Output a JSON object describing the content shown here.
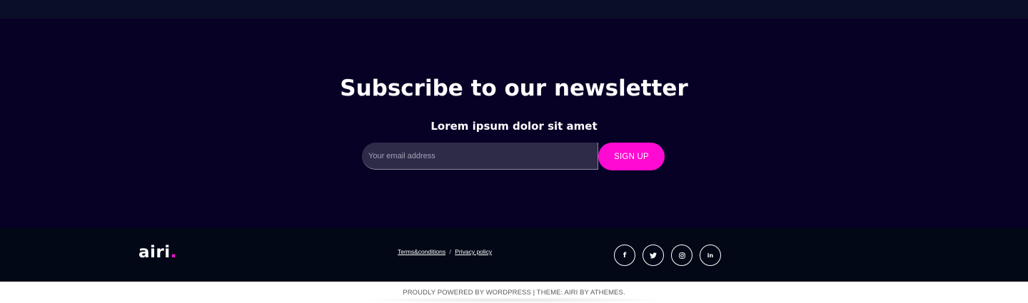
{
  "newsletter": {
    "title": "Subscribe to our newsletter",
    "subtitle": "Lorem ipsum dolor sit amet",
    "email_placeholder": "Your email address",
    "email_value": "",
    "signup_label": "SIGN UP"
  },
  "footer": {
    "logo_text": "airi",
    "logo_dot": ".",
    "links": {
      "terms": "Terms&conditions",
      "separator": "/",
      "privacy": "Privacy policy"
    },
    "social": [
      {
        "icon": "facebook-icon",
        "glyph": "f"
      },
      {
        "icon": "twitter-icon",
        "glyph": ""
      },
      {
        "icon": "instagram-icon",
        "glyph": ""
      },
      {
        "icon": "linkedin-icon",
        "glyph": "in"
      }
    ]
  },
  "copyright": {
    "text": "PROUDLY POWERED BY WORDPRESS | THEME: AIRI BY ATHEMES."
  },
  "colors": {
    "accent": "#ff0ad2",
    "newsletter_bg": "#070126",
    "footer_bg": "#020816",
    "top_strip_bg": "#0a0e28",
    "input_bg": "#2d2b47"
  }
}
